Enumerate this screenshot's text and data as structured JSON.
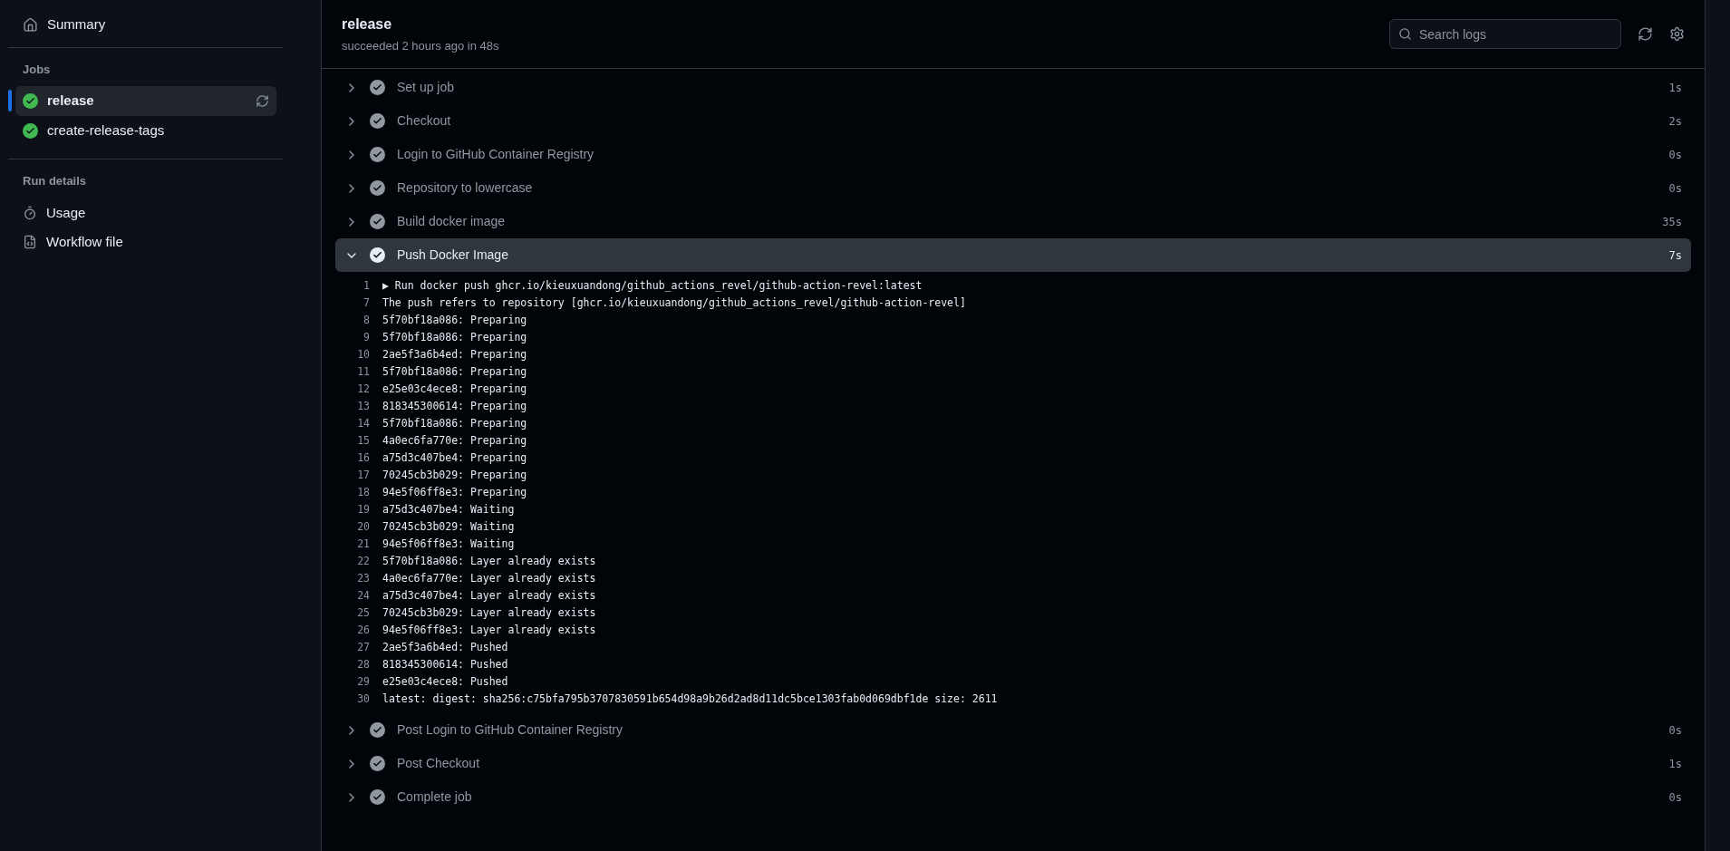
{
  "sidebar": {
    "summary": "Summary",
    "jobs_heading": "Jobs",
    "jobs": [
      {
        "name": "release",
        "selected": true,
        "succeeded": true
      },
      {
        "name": "create-release-tags",
        "selected": false,
        "succeeded": true
      }
    ],
    "run_details_heading": "Run details",
    "run_details": [
      {
        "label": "Usage",
        "kind": "usage"
      },
      {
        "label": "Workflow file",
        "kind": "workflow"
      }
    ]
  },
  "header": {
    "title": "release",
    "subtitle": "succeeded 2 hours ago in 48s",
    "search": {
      "placeholder": "Search logs"
    }
  },
  "steps": [
    {
      "name": "Set up job",
      "duration": "1s",
      "expanded": false
    },
    {
      "name": "Checkout",
      "duration": "2s",
      "expanded": false
    },
    {
      "name": "Login to GitHub Container Registry",
      "duration": "0s",
      "expanded": false
    },
    {
      "name": "Repository to lowercase",
      "duration": "0s",
      "expanded": false
    },
    {
      "name": "Build docker image",
      "duration": "35s",
      "expanded": false
    },
    {
      "name": "Push Docker Image",
      "duration": "7s",
      "expanded": true,
      "log": [
        {
          "n": "1",
          "text": "▶ Run docker push ghcr.io/kieuxuandong/github_actions_revel/github-action-revel:latest"
        },
        {
          "n": "7",
          "text": "The push refers to repository [ghcr.io/kieuxuandong/github_actions_revel/github-action-revel]"
        },
        {
          "n": "8",
          "text": "5f70bf18a086: Preparing"
        },
        {
          "n": "9",
          "text": "5f70bf18a086: Preparing"
        },
        {
          "n": "10",
          "text": "2ae5f3a6b4ed: Preparing"
        },
        {
          "n": "11",
          "text": "5f70bf18a086: Preparing"
        },
        {
          "n": "12",
          "text": "e25e03c4ece8: Preparing"
        },
        {
          "n": "13",
          "text": "818345300614: Preparing"
        },
        {
          "n": "14",
          "text": "5f70bf18a086: Preparing"
        },
        {
          "n": "15",
          "text": "4a0ec6fa770e: Preparing"
        },
        {
          "n": "16",
          "text": "a75d3c407be4: Preparing"
        },
        {
          "n": "17",
          "text": "70245cb3b029: Preparing"
        },
        {
          "n": "18",
          "text": "94e5f06ff8e3: Preparing"
        },
        {
          "n": "19",
          "text": "a75d3c407be4: Waiting"
        },
        {
          "n": "20",
          "text": "70245cb3b029: Waiting"
        },
        {
          "n": "21",
          "text": "94e5f06ff8e3: Waiting"
        },
        {
          "n": "22",
          "text": "5f70bf18a086: Layer already exists"
        },
        {
          "n": "23",
          "text": "4a0ec6fa770e: Layer already exists"
        },
        {
          "n": "24",
          "text": "a75d3c407be4: Layer already exists"
        },
        {
          "n": "25",
          "text": "70245cb3b029: Layer already exists"
        },
        {
          "n": "26",
          "text": "94e5f06ff8e3: Layer already exists"
        },
        {
          "n": "27",
          "text": "2ae5f3a6b4ed: Pushed"
        },
        {
          "n": "28",
          "text": "818345300614: Pushed"
        },
        {
          "n": "29",
          "text": "e25e03c4ece8: Pushed"
        },
        {
          "n": "30",
          "text": "latest: digest: sha256:c75bfa795b3707830591b654d98a9b26d2ad8d11dc5bce1303fab0d069dbf1de size: 2611"
        }
      ]
    },
    {
      "name": "Post Login to GitHub Container Registry",
      "duration": "0s",
      "expanded": false
    },
    {
      "name": "Post Checkout",
      "duration": "1s",
      "expanded": false
    },
    {
      "name": "Complete job",
      "duration": "0s",
      "expanded": false
    }
  ]
}
